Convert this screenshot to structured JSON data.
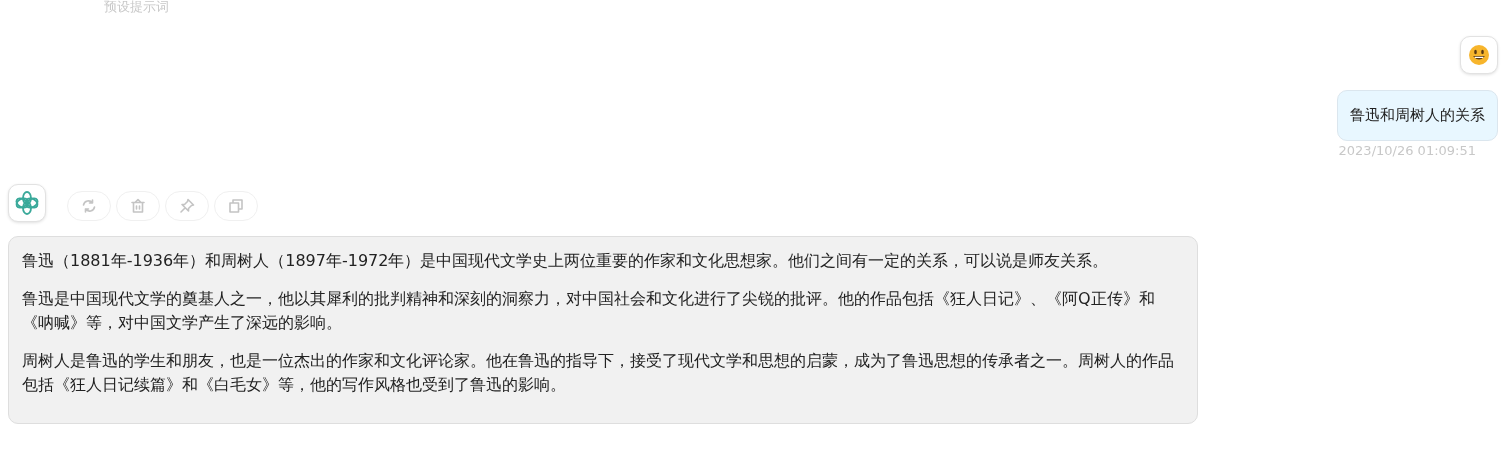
{
  "preset_prompt_label": "预设提示词",
  "user_message": {
    "text": "鲁迅和周树人的关系",
    "time": "2023/10/26 01:09:51"
  },
  "bot_actions": [
    {
      "kind": "refresh"
    },
    {
      "kind": "delete"
    },
    {
      "kind": "pin"
    },
    {
      "kind": "copy"
    }
  ],
  "bot_message": {
    "paragraphs": [
      "鲁迅（1881年-1936年）和周树人（1897年-1972年）是中国现代文学史上两位重要的作家和文化思想家。他们之间有一定的关系，可以说是师友关系。",
      "鲁迅是中国现代文学的奠基人之一，他以其犀利的批判精神和深刻的洞察力，对中国社会和文化进行了尖锐的批评。他的作品包括《狂人日记》、《阿Q正传》和《呐喊》等，对中国文学产生了深远的影响。",
      "周树人是鲁迅的学生和朋友，也是一位杰出的作家和文化评论家。他在鲁迅的指导下，接受了现代文学和思想的启蒙，成为了鲁迅思想的传承者之一。周树人的作品包括《狂人日记续篇》和《白毛女》等，他的写作风格也受到了鲁迅的影响。"
    ]
  }
}
